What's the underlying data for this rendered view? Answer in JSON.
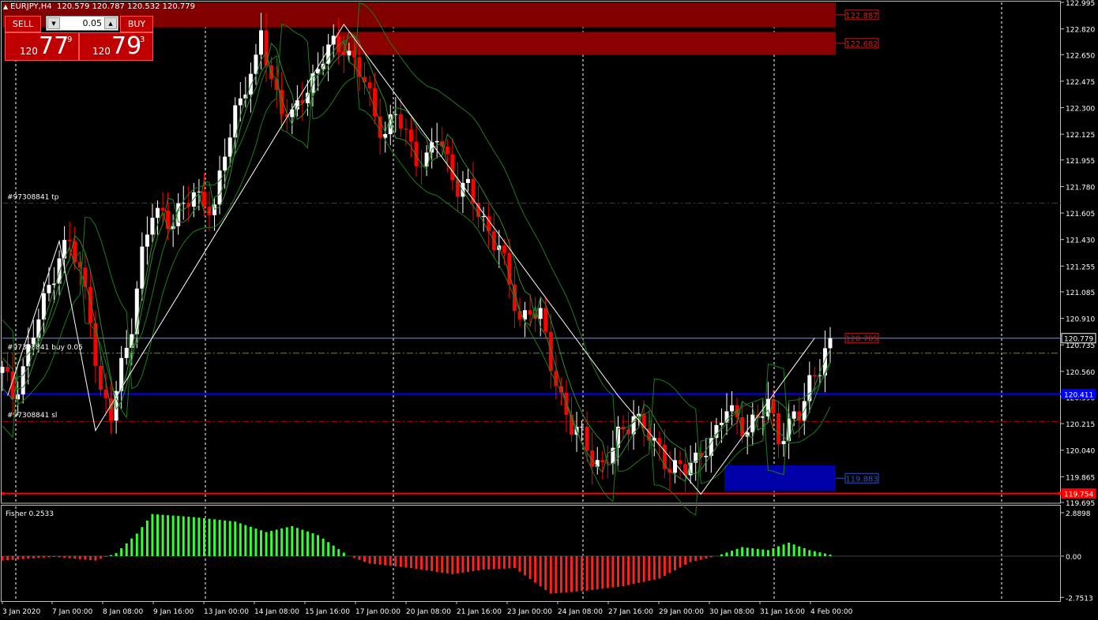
{
  "header": {
    "symbol_timeframe": "EURJPY,H4",
    "ohlc": "120.579 120.787 120.532 120.779"
  },
  "trade_panel": {
    "sell_label": "SELL",
    "buy_label": "BUY",
    "lot": "0.05",
    "sell_big": "120",
    "sell_pips": "77",
    "sell_frac": "9",
    "buy_big": "120",
    "buy_pips": "79",
    "buy_frac": "3"
  },
  "price_axis": {
    "ticks": [
      "122.995",
      "122.820",
      "122.650",
      "122.475",
      "122.300",
      "122.125",
      "121.955",
      "121.780",
      "121.605",
      "121.430",
      "121.255",
      "121.085",
      "120.910",
      "120.735",
      "120.560",
      "120.390",
      "120.215",
      "120.040",
      "119.865",
      "119.695"
    ],
    "labels": [
      {
        "text": "120.779",
        "value": 120.779,
        "style": "current"
      },
      {
        "text": "120.411",
        "value": 120.411,
        "style": "blue"
      },
      {
        "text": "119.754",
        "value": 119.754,
        "style": "red"
      }
    ]
  },
  "zones": [
    {
      "label": "122.887",
      "top": 122.995,
      "bottom": 122.83,
      "t0": 0,
      "t1": 197,
      "color": "#800000"
    },
    {
      "label": "122.682",
      "top": 122.8,
      "bottom": 122.65,
      "t0": 79,
      "t1": 197,
      "color": "#8b0000"
    },
    {
      "label": "119.883",
      "top": 119.94,
      "bottom": 119.77,
      "t0": 170,
      "t1": 197,
      "color": "#0000a8"
    }
  ],
  "h_lines": [
    {
      "value": 121.67,
      "color": "#c00000",
      "style": "dashdot",
      "label": "#97308841 tp"
    },
    {
      "value": 120.68,
      "color": "#6b8e23",
      "style": "dashdot",
      "label": "#97308841 buy 0.05"
    },
    {
      "value": 120.411,
      "color": "#0000ff",
      "style": "solid",
      "width": 2,
      "label": ""
    },
    {
      "value": 120.23,
      "color": "#c00000",
      "style": "dashdot",
      "label": "#97308841 sl"
    },
    {
      "value": 119.754,
      "color": "#ff0000",
      "style": "solid",
      "width": 2,
      "label": ""
    },
    {
      "value": 120.779,
      "color": "#8090c0",
      "style": "solid",
      "width": 1,
      "label": ""
    }
  ],
  "indicator": {
    "name": "Fisher 0.2533",
    "ticks": [
      "2.8898",
      "0.00",
      "-2.7513"
    ],
    "max": 2.8898,
    "min": -2.7513
  },
  "time_axis": [
    "3 Jan 2020",
    "7 Jan 00:00",
    "8 Jan 08:00",
    "9 Jan 16:00",
    "13 Jan 00:00",
    "14 Jan 08:00",
    "15 Jan 16:00",
    "17 Jan 00:00",
    "20 Jan 08:00",
    "21 Jan 16:00",
    "23 Jan 00:00",
    "24 Jan 08:00",
    "27 Jan 16:00",
    "29 Jan 00:00",
    "30 Jan 08:00",
    "31 Jan 16:00",
    "4 Feb 00:00"
  ],
  "chart_data": {
    "type": "candlestick",
    "symbol": "EURJPY",
    "timeframe": "H4",
    "ylim": [
      119.695,
      122.995
    ],
    "anchors": [
      [
        0,
        120.55
      ],
      [
        2,
        120.4
      ],
      [
        5,
        120.7
      ],
      [
        8,
        121.0
      ],
      [
        11,
        121.35
      ],
      [
        13,
        121.4
      ],
      [
        15,
        121.2
      ],
      [
        17,
        120.95
      ],
      [
        19,
        120.4
      ],
      [
        21,
        120.25
      ],
      [
        23,
        120.6
      ],
      [
        25,
        120.9
      ],
      [
        27,
        121.3
      ],
      [
        29,
        121.6
      ],
      [
        31,
        121.62
      ],
      [
        33,
        121.55
      ],
      [
        35,
        121.62
      ],
      [
        37,
        121.75
      ],
      [
        39,
        121.7
      ],
      [
        41,
        121.6
      ],
      [
        43,
        122.0
      ],
      [
        45,
        122.3
      ],
      [
        47,
        122.45
      ],
      [
        49,
        122.55
      ],
      [
        50,
        122.8
      ],
      [
        52,
        122.5
      ],
      [
        54,
        122.3
      ],
      [
        56,
        122.2
      ],
      [
        58,
        122.4
      ],
      [
        60,
        122.5
      ],
      [
        62,
        122.62
      ],
      [
        64,
        122.7
      ],
      [
        66,
        122.73
      ],
      [
        68,
        122.6
      ],
      [
        70,
        122.45
      ],
      [
        72,
        122.25
      ],
      [
        74,
        122.15
      ],
      [
        76,
        122.25
      ],
      [
        78,
        122.1
      ],
      [
        80,
        122.0
      ],
      [
        82,
        121.95
      ],
      [
        84,
        122.1
      ],
      [
        86,
        121.95
      ],
      [
        88,
        121.8
      ],
      [
        90,
        121.75
      ],
      [
        92,
        121.6
      ],
      [
        94,
        121.5
      ],
      [
        96,
        121.4
      ],
      [
        98,
        121.1
      ],
      [
        100,
        120.9
      ],
      [
        102,
        121.0
      ],
      [
        104,
        120.9
      ],
      [
        106,
        120.6
      ],
      [
        108,
        120.4
      ],
      [
        110,
        120.2
      ],
      [
        112,
        120.1
      ],
      [
        114,
        120.0
      ],
      [
        116,
        119.95
      ],
      [
        118,
        120.05
      ],
      [
        120,
        120.15
      ],
      [
        122,
        120.3
      ],
      [
        124,
        120.2
      ],
      [
        126,
        120.05
      ],
      [
        128,
        119.98
      ],
      [
        130,
        119.95
      ],
      [
        132,
        119.9
      ],
      [
        134,
        119.95
      ],
      [
        136,
        120.1
      ],
      [
        138,
        120.15
      ],
      [
        140,
        120.3
      ],
      [
        142,
        120.25
      ],
      [
        144,
        120.2
      ],
      [
        146,
        120.22
      ],
      [
        148,
        120.35
      ],
      [
        150,
        120.15
      ],
      [
        152,
        120.2
      ],
      [
        154,
        120.25
      ],
      [
        156,
        120.5
      ],
      [
        158,
        120.62
      ],
      [
        160,
        120.779
      ]
    ],
    "closes_source": "estimated from plot",
    "moving_averages": 4,
    "zigzag": [
      [
        1,
        120.4
      ],
      [
        11,
        121.42
      ],
      [
        18,
        120.17
      ],
      [
        66,
        122.85
      ],
      [
        119,
        120.4
      ],
      [
        135,
        119.75
      ],
      [
        157,
        120.78
      ]
    ],
    "fisher_anchors": [
      [
        0,
        -0.3
      ],
      [
        10,
        -0.05
      ],
      [
        18,
        -0.3
      ],
      [
        22,
        0.2
      ],
      [
        26,
        1.5
      ],
      [
        29,
        2.8
      ],
      [
        37,
        2.6
      ],
      [
        45,
        2.3
      ],
      [
        51,
        1.6
      ],
      [
        56,
        2.0
      ],
      [
        61,
        1.4
      ],
      [
        67,
        0.0
      ],
      [
        71,
        -0.5
      ],
      [
        79,
        -0.8
      ],
      [
        87,
        -1.2
      ],
      [
        93,
        -0.9
      ],
      [
        99,
        -0.8
      ],
      [
        106,
        -2.5
      ],
      [
        113,
        -2.3
      ],
      [
        120,
        -2.0
      ],
      [
        127,
        -1.5
      ],
      [
        133,
        -0.4
      ],
      [
        138,
        0.0
      ],
      [
        143,
        0.6
      ],
      [
        148,
        0.4
      ],
      [
        152,
        0.9
      ],
      [
        156,
        0.4
      ],
      [
        160,
        0.1
      ]
    ]
  }
}
